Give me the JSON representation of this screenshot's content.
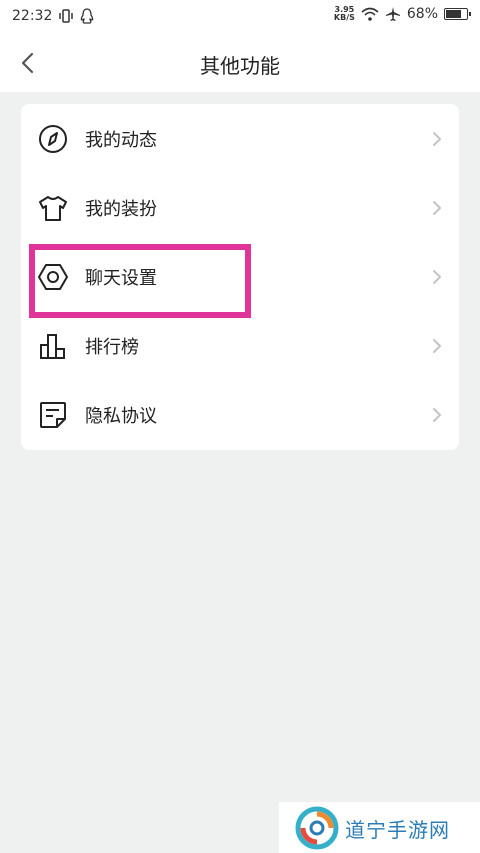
{
  "status_bar": {
    "time": "22:32",
    "net_speed_value": "3.95",
    "net_speed_unit": "KB/S",
    "battery": "68%",
    "battery_level": 0.68
  },
  "header": {
    "title": "其他功能",
    "back_icon": "chevron-left-icon"
  },
  "menu": {
    "items": [
      {
        "label": "我的动态",
        "icon": "compass-icon"
      },
      {
        "label": "我的装扮",
        "icon": "tshirt-icon"
      },
      {
        "label": "聊天设置",
        "icon": "hexagon-settings-icon"
      },
      {
        "label": "排行榜",
        "icon": "bar-chart-icon"
      },
      {
        "label": "隐私协议",
        "icon": "document-icon"
      }
    ],
    "highlighted_item": "聊天设置"
  },
  "colors": {
    "highlight": "#e0349a",
    "background": "#eff0f0",
    "card": "#ffffff",
    "watermark_text": "#2c7db7"
  },
  "watermark": {
    "text": "道宁手游网"
  }
}
